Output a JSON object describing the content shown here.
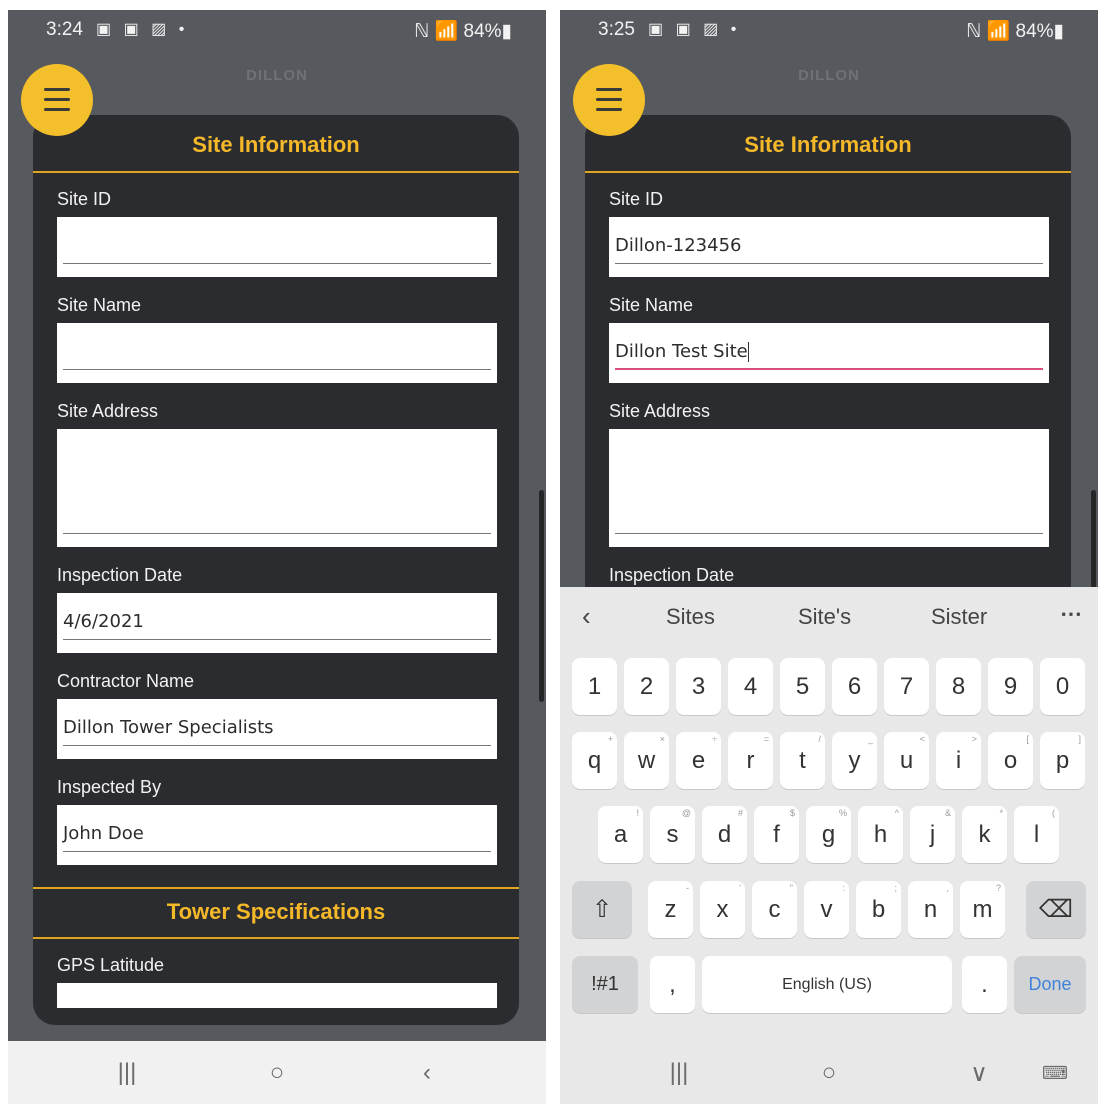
{
  "phone1": {
    "status": {
      "time": "3:24",
      "notif": "▣ ▣ ▨ •",
      "right": "ℕ 📶 84%▮"
    },
    "brand": "DILLON",
    "section_title": "Site Information",
    "fields": [
      {
        "label": "Site ID",
        "value": ""
      },
      {
        "label": "Site Name",
        "value": ""
      },
      {
        "label": "Site Address",
        "value": ""
      },
      {
        "label": "Inspection Date",
        "value": "4/6/2021"
      },
      {
        "label": "Contractor Name",
        "value": "Dillon Tower Specialists"
      },
      {
        "label": "Inspected By",
        "value": "John Doe"
      }
    ],
    "section2_title": "Tower Specifications",
    "field_gps_label": "GPS Latitude",
    "nav": {
      "recent": "|||",
      "home": "○",
      "back": "‹"
    }
  },
  "phone2": {
    "status": {
      "time": "3:25",
      "notif": "▣ ▣ ▨ •",
      "right": "ℕ 📶 84%▮"
    },
    "brand": "DILLON",
    "section_title": "Site Information",
    "fields": [
      {
        "label": "Site ID",
        "value": "Dillon-123456"
      },
      {
        "label": "Site Name",
        "value": "Dillon Test Site"
      },
      {
        "label": "Site Address",
        "value": ""
      },
      {
        "label": "Inspection Date",
        "value": ""
      }
    ],
    "keyboard": {
      "suggestions": [
        "Sites",
        "Site's",
        "Sister"
      ],
      "back": "‹",
      "more": "⋯",
      "row_numbers": [
        "1",
        "2",
        "3",
        "4",
        "5",
        "6",
        "7",
        "8",
        "9",
        "0"
      ],
      "row1": [
        "q",
        "w",
        "e",
        "r",
        "t",
        "y",
        "u",
        "i",
        "o",
        "p"
      ],
      "row1_hints": [
        "+",
        "×",
        "÷",
        "=",
        "/",
        "_",
        "<",
        ">",
        "[",
        "]"
      ],
      "row2": [
        "a",
        "s",
        "d",
        "f",
        "g",
        "h",
        "j",
        "k",
        "l"
      ],
      "row2_hints": [
        "!",
        "@",
        "#",
        "$",
        "%",
        "^",
        "&",
        "*",
        "("
      ],
      "row3": [
        "z",
        "x",
        "c",
        "v",
        "b",
        "n",
        "m"
      ],
      "row3_hints": [
        "-",
        "'",
        "\"",
        ":",
        ";",
        ",",
        "?"
      ],
      "shift": "⇧",
      "backspace": "⌫",
      "symbols": "!#1",
      "comma": ",",
      "space": "English (US)",
      "period": ".",
      "done": "Done"
    },
    "nav": {
      "recent": "|||",
      "home": "○",
      "hide": "∨",
      "keyboard": "⌨"
    }
  }
}
